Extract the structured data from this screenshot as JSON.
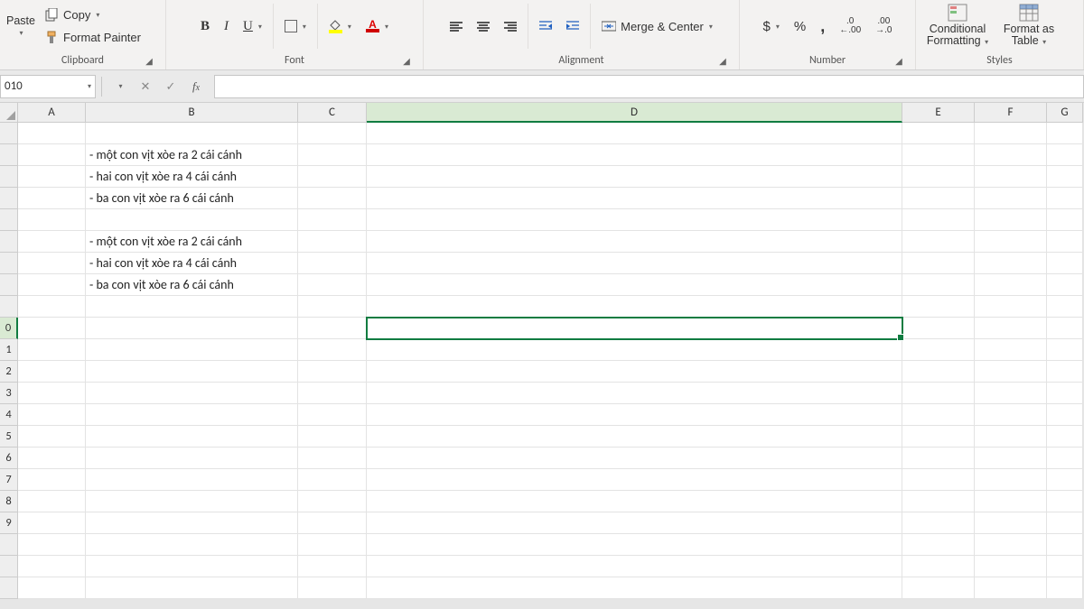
{
  "ribbon": {
    "clipboard": {
      "paste": "Paste",
      "copy": "Copy",
      "format_painter": "Format Painter",
      "label": "Clipboard"
    },
    "font": {
      "label": "Font"
    },
    "alignment": {
      "merge_center": "Merge & Center",
      "label": "Alignment"
    },
    "number": {
      "label": "Number"
    },
    "styles": {
      "conditional": "Conditional",
      "formatting": "Formatting",
      "format_as": "Format as",
      "table": "Table",
      "label": "Styles"
    }
  },
  "namebox": {
    "value": "010"
  },
  "formula": {
    "value": ""
  },
  "columns": [
    "A",
    "B",
    "C",
    "D",
    "E",
    "F",
    "G"
  ],
  "active_col": "D",
  "active_row_display": "0",
  "active_row_index": 10,
  "row_headers": [
    "",
    "",
    "",
    "",
    "",
    "",
    "",
    "",
    "",
    "0",
    "1",
    "2",
    "3",
    "4",
    "5",
    "6",
    "7",
    "8",
    "9"
  ],
  "cells": {
    "B2": "- một con vịt xòe ra 2 cái cánh",
    "B3": "- hai con vịt xòe ra 4 cái cánh",
    "B4": "- ba con vịt xòe ra 6 cái cánh",
    "B6": "- một con vịt xòe ra 2 cái cánh",
    "B7": "- hai con vịt xòe ra 4 cái cánh",
    "B8": "- ba con vịt xòe ra 6 cái cánh"
  }
}
